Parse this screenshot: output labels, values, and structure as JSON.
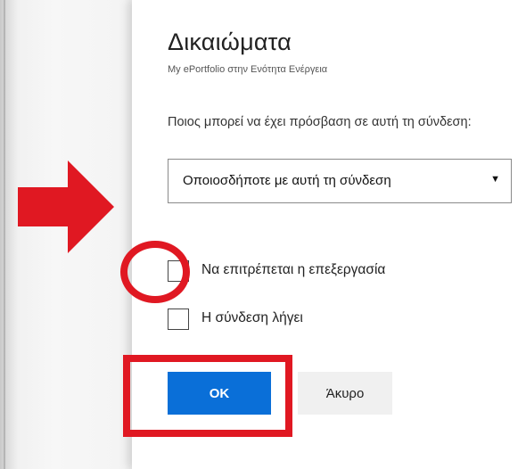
{
  "dialog": {
    "title": "Δικαιώματα",
    "subtitle": "My ePortfolio στην Ενότητα Ενέργεια",
    "access_question": "Ποιος μπορεί να έχει πρόσβαση σε αυτή τη σύνδεση:",
    "access_select": {
      "selected": "Οποιοσδήποτε με αυτή τη σύνδεση",
      "caret": "▼"
    },
    "checkboxes": [
      {
        "label": "Να επιτρέπεται η επεξεργασία",
        "checked": false
      },
      {
        "label": "Η σύνδεση λήγει",
        "checked": false
      }
    ],
    "ok_label": "OK",
    "cancel_label": "Άκυρο"
  },
  "colors": {
    "primary_button": "#0a6fd8",
    "secondary_button": "#f0f0f0",
    "annotation_red": "#e01822"
  },
  "annotations": {
    "arrow_icon": "arrow-right-icon",
    "highlight_circle": "circle-highlight",
    "highlight_rect": "rect-highlight"
  }
}
